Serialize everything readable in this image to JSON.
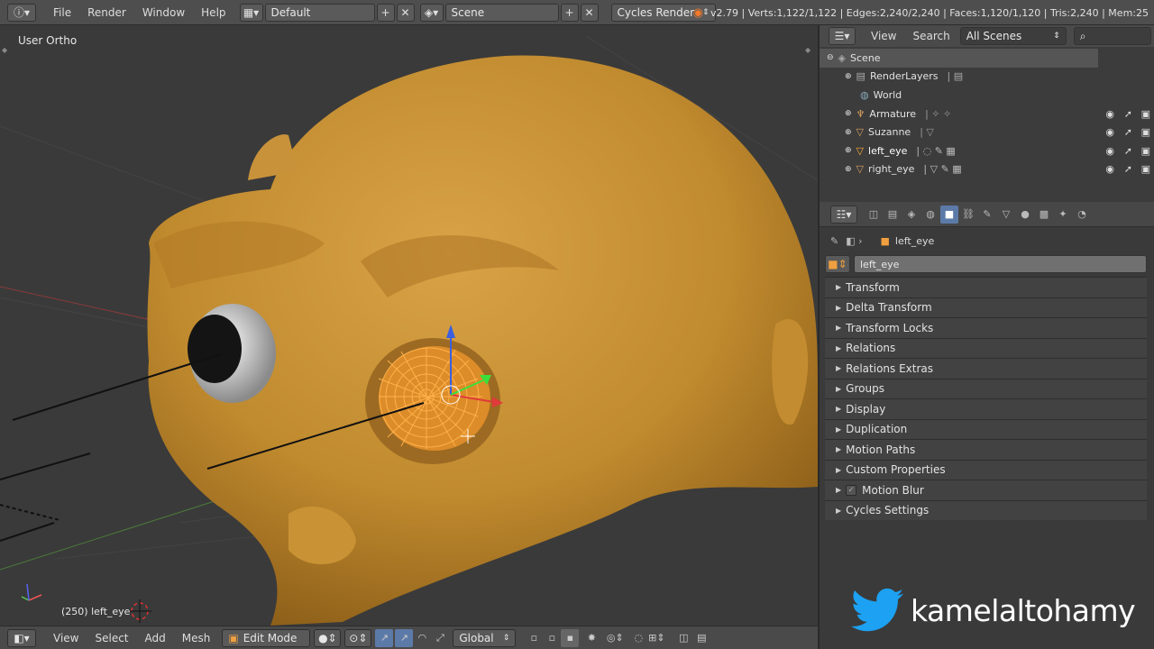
{
  "topbar": {
    "menus": [
      "File",
      "Render",
      "Window",
      "Help"
    ],
    "layout": "Default",
    "scene": "Scene",
    "engine": "Cycles Render",
    "stats": "v2.79 | Verts:1,122/1,122 | Edges:2,240/2,240 | Faces:1,120/1,120 | Tris:2,240 | Mem:25"
  },
  "viewport": {
    "view_label": "User Ortho",
    "object_label": "(250) left_eye"
  },
  "bottombar": {
    "menus": [
      "View",
      "Select",
      "Add",
      "Mesh"
    ],
    "mode": "Edit Mode",
    "orientation": "Global"
  },
  "outliner": {
    "view": "View",
    "search": "Search",
    "filter": "All Scenes",
    "items": [
      {
        "label": "Scene"
      },
      {
        "label": "RenderLayers"
      },
      {
        "label": "World"
      },
      {
        "label": "Armature"
      },
      {
        "label": "Suzanne"
      },
      {
        "label": "left_eye"
      },
      {
        "label": "right_eye"
      }
    ]
  },
  "properties": {
    "breadcrumb": "left_eye",
    "object_name": "left_eye",
    "panels": [
      "Transform",
      "Delta Transform",
      "Transform Locks",
      "Relations",
      "Relations Extras",
      "Groups",
      "Display",
      "Duplication",
      "Motion Paths",
      "Custom Properties",
      "Motion Blur",
      "Cycles Settings"
    ]
  },
  "watermark": {
    "text": "kamelaltohamy"
  },
  "colors": {
    "accent_blue": "#5c7aa8",
    "mesh_orange": "#ff9a2e",
    "twitter_blue": "#1da1f2"
  }
}
